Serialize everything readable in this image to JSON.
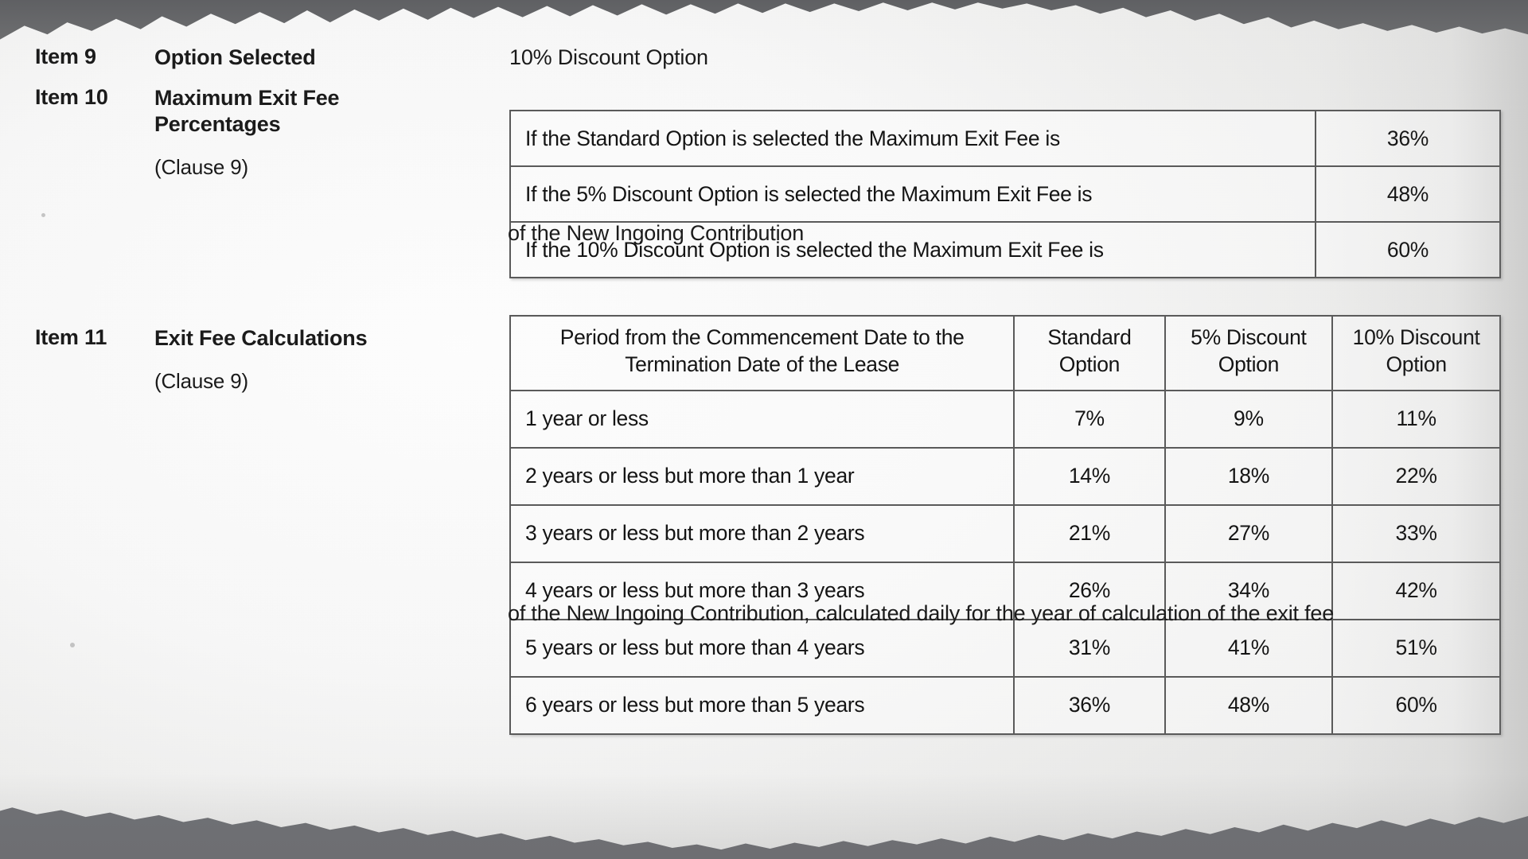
{
  "document": {
    "items": [
      {
        "number": "Item 9",
        "title": "Option Selected",
        "clause": "",
        "value": "10% Discount Option"
      },
      {
        "number": "Item 10",
        "title": "Maximum Exit Fee Percentages",
        "clause": "(Clause 9)",
        "footnote": "of the New Ingoing Contribution"
      },
      {
        "number": "Item 11",
        "title": "Exit Fee Calculations",
        "clause": "(Clause 9)",
        "footnote": "of the New Ingoing Contribution, calculated daily for the year of calculation of the exit fee"
      }
    ],
    "max_exit_fee_table": {
      "rows": [
        {
          "description": "If the Standard Option is selected the Maximum Exit Fee is",
          "percentage": "36%"
        },
        {
          "description": "If the 5% Discount Option is selected the Maximum Exit Fee is",
          "percentage": "48%"
        },
        {
          "description": "If the 10% Discount Option is selected the Maximum Exit Fee is",
          "percentage": "60%"
        }
      ]
    },
    "exit_fee_calculations_table": {
      "headers": {
        "period": "Period from the Commencement Date to the Termination Date of the Lease",
        "standard": "Standard Option",
        "discount5": "5% Discount Option",
        "discount10": "10% Discount Option"
      },
      "rows": [
        {
          "period": "1 year or less",
          "standard": "7%",
          "discount5": "9%",
          "discount10": "11%"
        },
        {
          "period": "2 years or less but more than 1 year",
          "standard": "14%",
          "discount5": "18%",
          "discount10": "22%"
        },
        {
          "period": "3 years or less but more than 2 years",
          "standard": "21%",
          "discount5": "27%",
          "discount10": "33%"
        },
        {
          "period": "4 years or less but more than 3 years",
          "standard": "26%",
          "discount5": "34%",
          "discount10": "42%"
        },
        {
          "period": "5 years or less but more than 4 years",
          "standard": "31%",
          "discount5": "41%",
          "discount10": "51%"
        },
        {
          "period": "6 years or less but more than 5 years",
          "standard": "36%",
          "discount5": "48%",
          "discount10": "60%"
        }
      ]
    }
  }
}
